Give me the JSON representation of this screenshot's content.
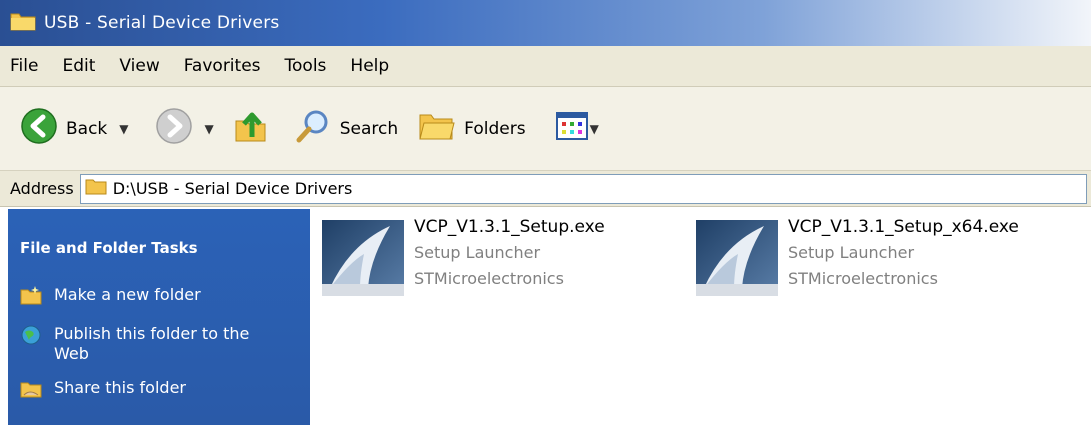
{
  "window": {
    "title": "USB - Serial Device Drivers"
  },
  "menu": [
    "File",
    "Edit",
    "View",
    "Favorites",
    "Tools",
    "Help"
  ],
  "toolbar": {
    "back_label": "Back",
    "search_label": "Search",
    "folders_label": "Folders"
  },
  "address": {
    "label": "Address",
    "value": "D:\\USB - Serial Device Drivers"
  },
  "tasks": {
    "header": "File and Folder Tasks",
    "items": [
      {
        "label": "Make a new folder",
        "icon": "new-folder-icon"
      },
      {
        "label": "Publish this folder to the Web",
        "icon": "publish-web-icon"
      },
      {
        "label": "Share this folder",
        "icon": "share-folder-icon"
      }
    ]
  },
  "files": [
    {
      "name": "VCP_V1.3.1_Setup.exe",
      "description": "Setup Launcher",
      "company": "STMicroelectronics"
    },
    {
      "name": "VCP_V1.3.1_Setup_x64.exe",
      "description": "Setup Launcher",
      "company": "STMicroelectronics"
    }
  ],
  "colors": {
    "title_gradient_start": "#2a4f93",
    "task_pane": "#2b62b7",
    "menu_bg": "#ece9d8"
  }
}
